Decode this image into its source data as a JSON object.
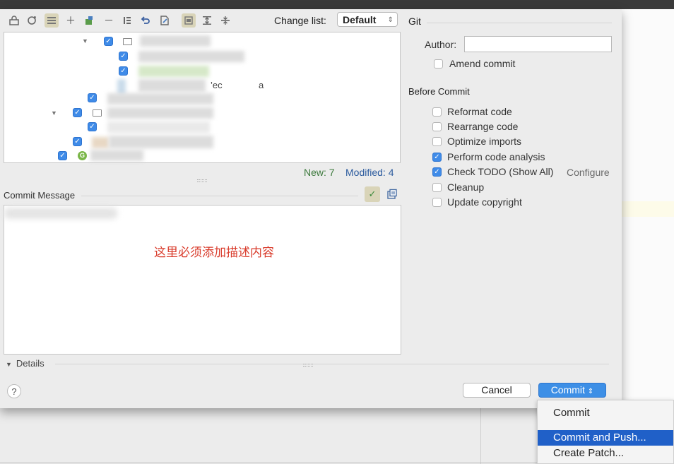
{
  "toolbar": {
    "icons": [
      "commit-icon",
      "refresh-icon",
      "group-icon",
      "add-icon",
      "move-icon",
      "remove-icon",
      "diff-icon",
      "undo-icon",
      "edit-icon",
      "preview-icon",
      "expand-all-icon",
      "collapse-all-icon"
    ]
  },
  "changelist": {
    "label": "Change list:",
    "value": "Default"
  },
  "tree": {
    "partial_text_1": "’ec",
    "partial_text_2": "a"
  },
  "stats": {
    "new": "New: 7",
    "modified": "Modified: 4"
  },
  "commit_message": {
    "label": "Commit Message",
    "note": "这里必须添加描述内容"
  },
  "details": {
    "label": "Details"
  },
  "help": {
    "label": "?"
  },
  "buttons": {
    "cancel": "Cancel",
    "commit": "Commit"
  },
  "git": {
    "title": "Git",
    "author_label": "Author:",
    "author_value": "",
    "amend": "Amend commit"
  },
  "before_commit": {
    "title": "Before Commit",
    "options": [
      {
        "label": "Reformat code",
        "checked": false
      },
      {
        "label": "Rearrange code",
        "checked": false
      },
      {
        "label": "Optimize imports",
        "checked": false
      },
      {
        "label": "Perform code analysis",
        "checked": true
      },
      {
        "label": "Check TODO (Show All)",
        "checked": true
      },
      {
        "label": "Cleanup",
        "checked": false
      },
      {
        "label": "Update copyright",
        "checked": false
      }
    ],
    "configure": "Configure"
  },
  "menu": {
    "items": [
      "Commit",
      "Commit and Push...",
      "Create Patch..."
    ],
    "selected": "Commit and Push..."
  },
  "colors": {
    "accent": "#3d8fe6",
    "menu_selected": "#2060c8",
    "note_red": "#d93b2b",
    "new_green": "#3d7a3d",
    "modified_blue": "#2c5b9e"
  }
}
